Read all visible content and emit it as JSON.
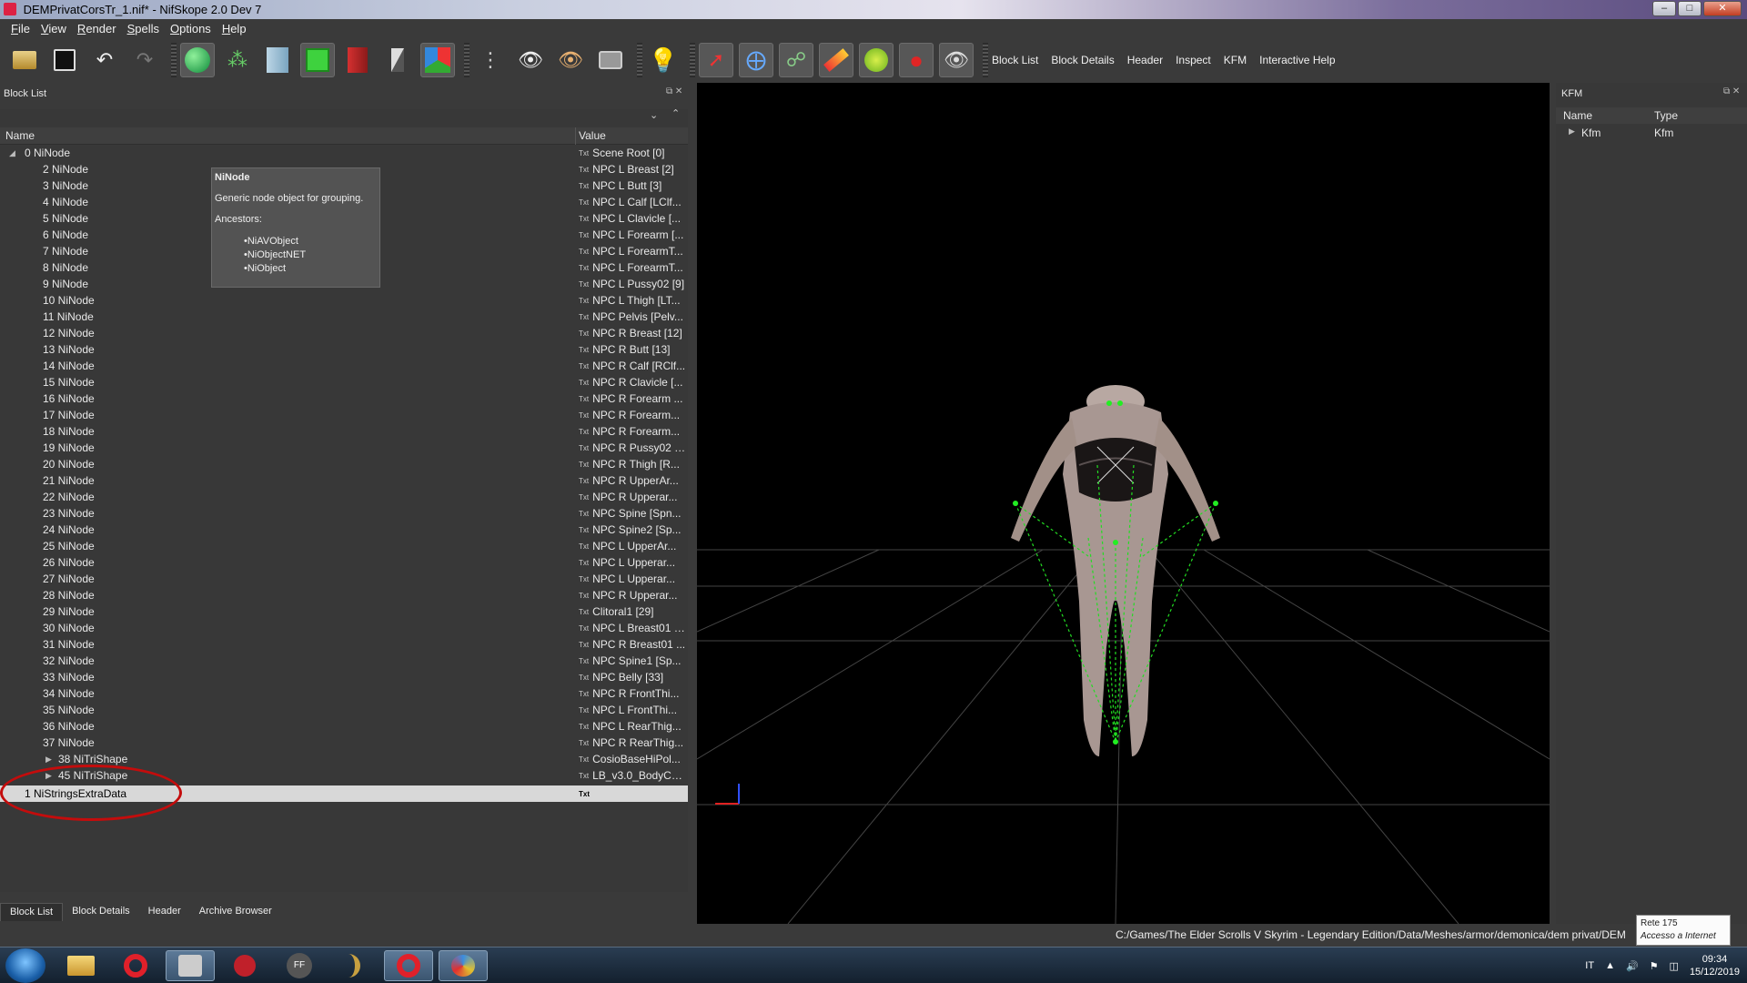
{
  "window": {
    "title": "DEMPrivatCorsTr_1.nif* - NifSkope 2.0 Dev 7",
    "controls": [
      "minimize-icon",
      "maximize-icon",
      "close-icon"
    ]
  },
  "menu": [
    "File",
    "View",
    "Render",
    "Spells",
    "Options",
    "Help"
  ],
  "toolbar": {
    "text_buttons": [
      "Block List",
      "Block Details",
      "Header",
      "Inspect",
      "KFM",
      "Interactive Help"
    ]
  },
  "block_list": {
    "title": "Block List",
    "columns": {
      "name": "Name",
      "value": "Value"
    },
    "root": {
      "name": "0 NiNode",
      "value": "Scene Root [0]"
    },
    "rows": [
      {
        "name": "2 NiNode",
        "value": "NPC L Breast [2]"
      },
      {
        "name": "3 NiNode",
        "value": "NPC L Butt [3]"
      },
      {
        "name": "4 NiNode",
        "value": "NPC L Calf [LClf..."
      },
      {
        "name": "5 NiNode",
        "value": "NPC L Clavicle [..."
      },
      {
        "name": "6 NiNode",
        "value": "NPC L Forearm [..."
      },
      {
        "name": "7 NiNode",
        "value": "NPC L ForearmT..."
      },
      {
        "name": "8 NiNode",
        "value": "NPC L ForearmT..."
      },
      {
        "name": "9 NiNode",
        "value": "NPC L Pussy02 [9]"
      },
      {
        "name": "10 NiNode",
        "value": "NPC L Thigh [LT..."
      },
      {
        "name": "11 NiNode",
        "value": "NPC Pelvis [Pelv..."
      },
      {
        "name": "12 NiNode",
        "value": "NPC R Breast [12]"
      },
      {
        "name": "13 NiNode",
        "value": "NPC R Butt [13]"
      },
      {
        "name": "14 NiNode",
        "value": "NPC R Calf [RClf..."
      },
      {
        "name": "15 NiNode",
        "value": "NPC R Clavicle [..."
      },
      {
        "name": "16 NiNode",
        "value": "NPC R Forearm ..."
      },
      {
        "name": "17 NiNode",
        "value": "NPC R Forearm..."
      },
      {
        "name": "18 NiNode",
        "value": "NPC R Forearm..."
      },
      {
        "name": "19 NiNode",
        "value": "NPC R Pussy02 [..."
      },
      {
        "name": "20 NiNode",
        "value": "NPC R Thigh [R..."
      },
      {
        "name": "21 NiNode",
        "value": "NPC R UpperAr..."
      },
      {
        "name": "22 NiNode",
        "value": "NPC R Upperar..."
      },
      {
        "name": "23 NiNode",
        "value": "NPC Spine [Spn..."
      },
      {
        "name": "24 NiNode",
        "value": "NPC Spine2 [Sp..."
      },
      {
        "name": "25 NiNode",
        "value": "NPC L UpperAr..."
      },
      {
        "name": "26 NiNode",
        "value": "NPC L Upperar..."
      },
      {
        "name": "27 NiNode",
        "value": "NPC L Upperar..."
      },
      {
        "name": "28 NiNode",
        "value": "NPC R Upperar..."
      },
      {
        "name": "29 NiNode",
        "value": "Clitoral1 [29]"
      },
      {
        "name": "30 NiNode",
        "value": "NPC L Breast01 [..."
      },
      {
        "name": "31 NiNode",
        "value": "NPC R Breast01 ..."
      },
      {
        "name": "32 NiNode",
        "value": "NPC Spine1 [Sp..."
      },
      {
        "name": "33 NiNode",
        "value": "NPC Belly [33]"
      },
      {
        "name": "34 NiNode",
        "value": "NPC R FrontThi..."
      },
      {
        "name": "35 NiNode",
        "value": "NPC L FrontThi..."
      },
      {
        "name": "36 NiNode",
        "value": "NPC L RearThig..."
      },
      {
        "name": "37 NiNode",
        "value": "NPC R RearThig..."
      }
    ],
    "shapes": [
      {
        "name": "38 NiTriShape",
        "value": "CosioBaseHiPol..."
      },
      {
        "name": "45 NiTriShape",
        "value": "LB_v3.0_BodyCo..."
      }
    ],
    "selected": {
      "name": "1 NiStringsExtraData",
      "value": ""
    },
    "txt_badge": "Txt"
  },
  "tooltip": {
    "title": "NiNode",
    "description": "Generic node object for grouping.",
    "ancestors_label": "Ancestors:",
    "ancestors": [
      "NiAVObject",
      "NiObjectNET",
      "NiObject"
    ]
  },
  "bottom_tabs": [
    "Block List",
    "Block Details",
    "Header",
    "Archive Browser"
  ],
  "kfm": {
    "title": "KFM",
    "columns": {
      "name": "Name",
      "type": "Type"
    },
    "row": {
      "name": "Kfm",
      "type": "Kfm"
    }
  },
  "status": {
    "path": "C:/Games/The Elder Scrolls V Skyrim - Legendary Edition/Data/Meshes/armor/demonica/dem privat/DEM"
  },
  "network_tooltip": {
    "line1": "Rete 175",
    "line2": "Accesso a Internet"
  },
  "taskbar": {
    "lang": "IT",
    "time": "09:34",
    "date": "15/12/2019"
  },
  "colors": {
    "selection_ring": "#c40c0c",
    "skeleton": "#22dd22",
    "viewport_bg": "#000000"
  }
}
